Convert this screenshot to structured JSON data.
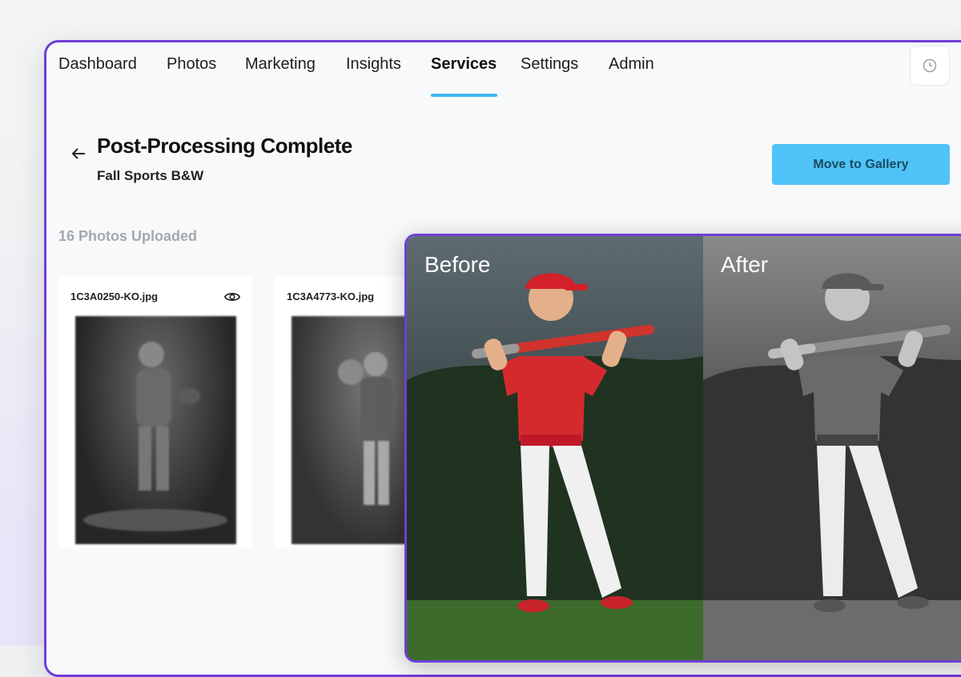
{
  "nav": {
    "items": [
      {
        "label": "Dashboard",
        "active": false
      },
      {
        "label": "Photos",
        "active": false
      },
      {
        "label": "Marketing",
        "active": false
      },
      {
        "label": "Insights",
        "active": false
      },
      {
        "label": "Services",
        "active": true
      },
      {
        "label": "Settings",
        "active": false
      },
      {
        "label": "Admin",
        "active": false
      }
    ],
    "history_icon": "clock-icon"
  },
  "header": {
    "back_icon": "arrow-left-icon",
    "title": "Post-Processing Complete",
    "subtitle": "Fall Sports B&W",
    "move_button_label": "Move to Gallery"
  },
  "gallery": {
    "count_label": "16 Photos Uploaded",
    "cards": [
      {
        "filename": "1C3A0250-KO.jpg",
        "icon": "eye-icon"
      },
      {
        "filename": "1C3A4773-KO.jpg",
        "icon": "eye-icon"
      }
    ]
  },
  "comparison": {
    "before_label": "Before",
    "after_label": "After"
  },
  "colors": {
    "accent_purple": "#6d3fd8",
    "accent_blue": "#4fc3f7",
    "nav_underline": "#3cb7f0"
  }
}
